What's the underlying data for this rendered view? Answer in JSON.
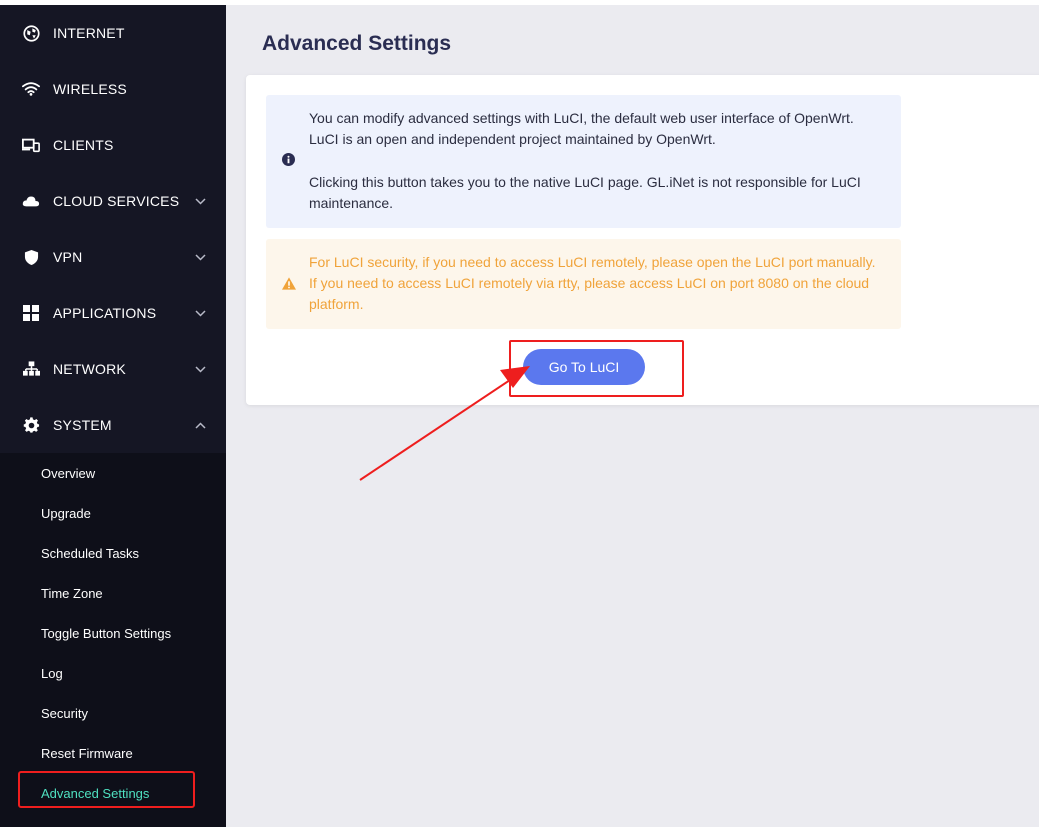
{
  "sidebar": {
    "items": [
      {
        "label": "INTERNET",
        "icon": "globe-icon"
      },
      {
        "label": "WIRELESS",
        "icon": "wifi-icon"
      },
      {
        "label": "CLIENTS",
        "icon": "devices-icon"
      },
      {
        "label": "CLOUD SERVICES",
        "icon": "cloud-icon"
      },
      {
        "label": "VPN",
        "icon": "shield-icon"
      },
      {
        "label": "APPLICATIONS",
        "icon": "apps-icon"
      },
      {
        "label": "NETWORK",
        "icon": "network-icon"
      },
      {
        "label": "SYSTEM",
        "icon": "gear-icon"
      }
    ],
    "system_submenu": [
      "Overview",
      "Upgrade",
      "Scheduled Tasks",
      "Time Zone",
      "Toggle Button Settings",
      "Log",
      "Security",
      "Reset Firmware",
      "Advanced Settings"
    ],
    "active_submenu": "Advanced Settings"
  },
  "main": {
    "title": "Advanced Settings",
    "info_line1": "You can modify advanced settings with LuCI, the default web user interface of OpenWrt.",
    "info_line2": "LuCI is an open and independent project maintained by OpenWrt.",
    "info_line3": "Clicking this button takes you to the native LuCI page. GL.iNet is not responsible for LuCI maintenance.",
    "warn_line1": "For LuCI security, if you need to access LuCI remotely, please open the LuCI port manually.",
    "warn_line2": "If you need to access LuCI remotely via rtty, please access LuCI on port 8080 on the cloud platform.",
    "go_button": "Go To LuCI"
  },
  "colors": {
    "sidebar_bg": "#151624",
    "active_text": "#4fe0c0",
    "button": "#5b78ee",
    "warning_text": "#f0a33a",
    "annotation_red": "#ee1e1e"
  }
}
